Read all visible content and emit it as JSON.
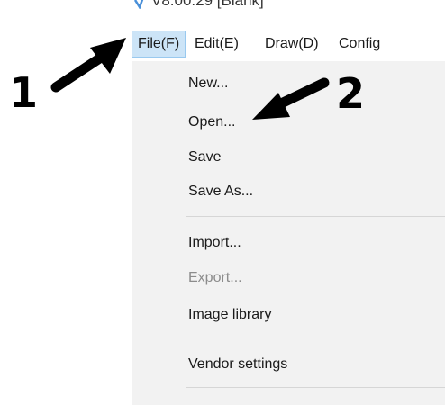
{
  "window": {
    "title": "V8.00.29 [Blank]",
    "app_icon": "app-logo-icon"
  },
  "menubar": {
    "items": [
      {
        "label": "File(F)",
        "active": true
      },
      {
        "label": "Edit(E)",
        "active": false
      },
      {
        "label": "Draw(D)",
        "active": false
      },
      {
        "label": "Config",
        "active": false
      }
    ]
  },
  "file_menu": {
    "items": [
      {
        "label": "New...",
        "enabled": true
      },
      {
        "label": "Open...",
        "enabled": true
      },
      {
        "label": "Save",
        "enabled": true
      },
      {
        "label": "Save As...",
        "enabled": true
      },
      {
        "label": "Import...",
        "enabled": true
      },
      {
        "label": "Export...",
        "enabled": false
      },
      {
        "label": "Image library",
        "enabled": true
      },
      {
        "label": "Vendor settings",
        "enabled": true
      }
    ]
  },
  "annotations": {
    "step1": "1",
    "step2": "2",
    "arrow_icon": "black-arrow-icon"
  },
  "colors": {
    "menu_highlight": "#cce4f7",
    "menu_highlight_border": "#99c9ef",
    "dropdown_bg": "#f2f2f2",
    "disabled_text": "#8c8c8c"
  }
}
